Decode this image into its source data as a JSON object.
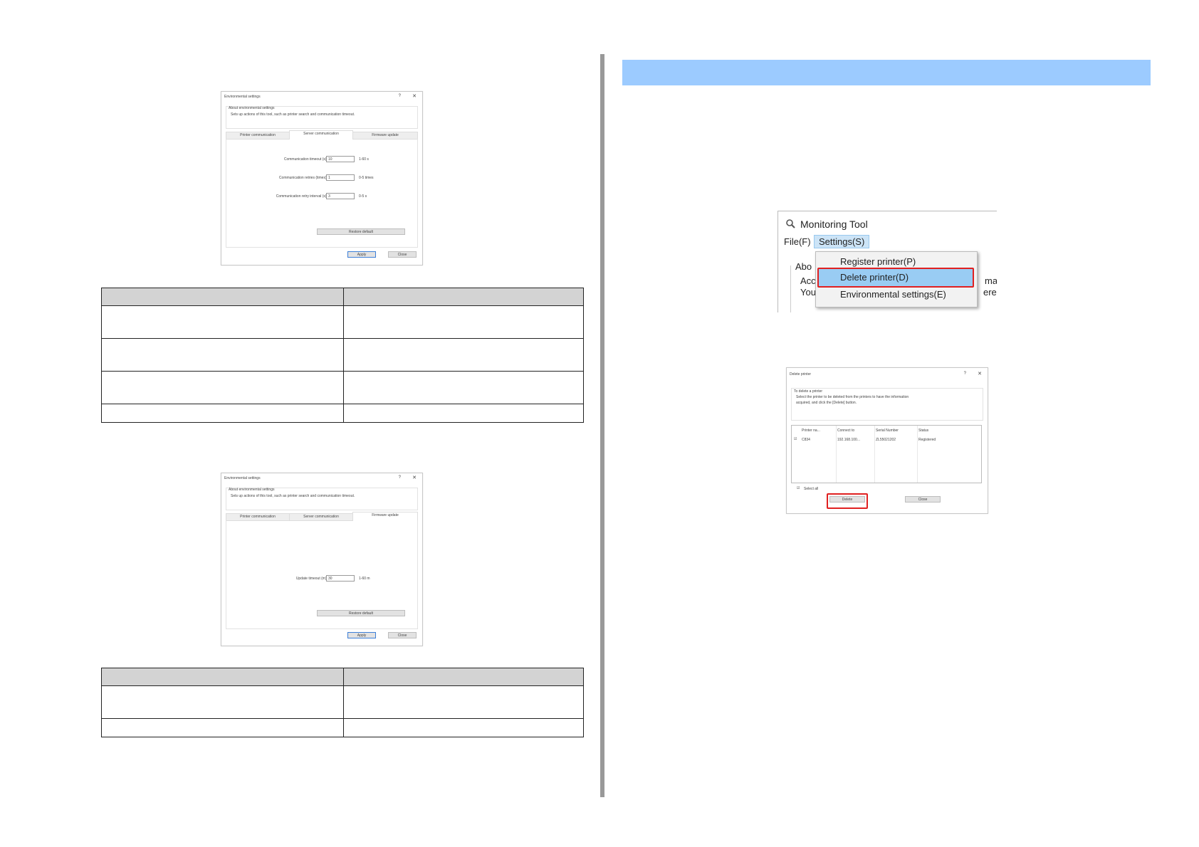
{
  "env_firmware_tab": {
    "title": "Environmental settings",
    "help": "?",
    "close": "✕",
    "about_heading": "About environmental settings",
    "about_desc": "Sets up actions of this tool, such as printer search and communication timeout.",
    "tabs": [
      "Printer communication",
      "Server communication",
      "Firmware update"
    ]
  },
  "env_server": {
    "fields": [
      {
        "label": "Communication timeout (s):",
        "value": "10",
        "range": "1-60 s"
      },
      {
        "label": "Communication retries (times):",
        "value": "1",
        "range": "0-5 times"
      },
      {
        "label": "Communication retry interval (s):",
        "value": "3",
        "range": "0-5 s"
      }
    ],
    "restore": "Restore default",
    "apply": "Apply",
    "close_btn": "Close"
  },
  "env_firmware": {
    "fields": [
      {
        "label": "Update timeout (m):",
        "value": "30",
        "range": "1-60 m"
      }
    ],
    "restore": "Restore default",
    "apply": "Apply",
    "close_btn": "Close"
  },
  "monitoring": {
    "icon": "magnifier-icon",
    "title": "Monitoring Tool",
    "menus": [
      "File(F)",
      "Settings(S)"
    ],
    "bg_fragments": [
      "Abo",
      "Acc",
      "You",
      "ma",
      "ere"
    ],
    "menu_items": [
      "Register printer(P)",
      "Delete printer(D)",
      "Environmental settings(E)"
    ]
  },
  "delete_dialog": {
    "title": "Delete printer",
    "help": "?",
    "close": "✕",
    "about_heading": "To delete a printer",
    "about_desc1": "Select the printer to be deleted from the printers to have the information",
    "about_desc2": "acquired, and click the [Delete] button.",
    "columns": [
      "Printer na...",
      "Connect to",
      "Serial Number",
      "Status"
    ],
    "row": {
      "check": "☑",
      "name": "C834",
      "connect": "192.168.100...",
      "serial": "ZL55021202",
      "status": "Registered"
    },
    "select_all_check": "☑",
    "select_all": "Select all",
    "delete_btn": "Delete",
    "close_btn": "Close"
  }
}
